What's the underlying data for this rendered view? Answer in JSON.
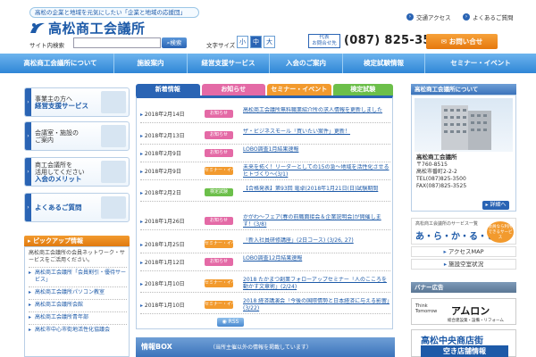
{
  "header": {
    "tagline": "高松の企業と地域を元気にしたい「企業と地域の応援団」",
    "logo_text": "高松商工会議所",
    "search_label": "サイト内検索",
    "search_placeholder": "",
    "search_button": "検索",
    "fontsize_label": "文字サイズ",
    "fontsize_options": [
      "小",
      "中",
      "大"
    ],
    "rep_tel_label": "代表\nお問合せ先",
    "tel_number": "(087) 825-3500",
    "contact_button": "お問い合せ",
    "toplinks": [
      "交通アクセス",
      "よくあるご質問"
    ]
  },
  "nav": {
    "items": [
      "高松商工会議所について",
      "施設案内",
      "経営支援サービス",
      "入会のご案内",
      "検定試験情報",
      "セミナー・イベント"
    ]
  },
  "left": {
    "boxes": [
      {
        "line1": "事業主の方へ",
        "line2": "経営支援サービス"
      },
      {
        "line1": "会議室・施設の",
        "line2": "ご案内"
      },
      {
        "line1": "商工会議所を",
        "line1b": "活用してください",
        "line2": "入会のメリット"
      },
      {
        "line1": "",
        "line2": "よくあるご質問"
      }
    ],
    "pickup_title": "ピックアップ情報",
    "pickup_desc": "高松商工会議所の会員ネットワーク・サービスをご活用ください。",
    "pickup_items": [
      "高松商工会議所「会員割引・優待サービス」",
      "高松商工会議所パソコン教室",
      "高松商工会議所会館",
      "高松商工会議所青年部",
      "高松市中心市街地活性化協議会"
    ]
  },
  "center": {
    "tabs": [
      {
        "label": "新着情報",
        "color": "#2a64b4"
      },
      {
        "label": "お知らせ",
        "color": "#e46aa6"
      },
      {
        "label": "セミナー・イベント",
        "color": "#f29a2e"
      },
      {
        "label": "検定試験",
        "color": "#6cbf4a"
      }
    ],
    "news": [
      {
        "date": "2018年2月14日",
        "badge": "お知らせ",
        "badge_color": "#e46aa6",
        "title": "高松商工会議所無料職業紹介所の求人情報を更新しました"
      },
      {
        "date": "2018年2月13日",
        "badge": "お知らせ",
        "badge_color": "#e46aa6",
        "title": "ザ・ビジネスモール「買いたい案件」更新！"
      },
      {
        "date": "2018年2月9日",
        "badge": "お知らせ",
        "badge_color": "#e46aa6",
        "title": "LOBO調査1月結果速報"
      },
      {
        "date": "2018年2月9日",
        "badge": "セミナー・イベント",
        "badge_color": "#f29a2e",
        "title": "未来を拓く！リーダーとしての15の急～地域を活性化させるヒトづくり～(3/1)"
      },
      {
        "date": "2018年2月2日",
        "badge": "検定試験",
        "badge_color": "#6cbf4a",
        "title": "【合格発表】第93回 電卓(2018年1月21日(日)試験期間"
      },
      {
        "date": "2018年1月26日",
        "badge": "お知らせ",
        "badge_color": "#e46aa6",
        "title": "かがわ～フェア(春の前職面接会＆企業説明会)が開催します！(3/8)"
      },
      {
        "date": "2018年1月25日",
        "badge": "セミナー・イベント",
        "badge_color": "#f29a2e",
        "title": "「新入社員研修講座」(2日コース) (3/26, 27)"
      },
      {
        "date": "2018年1月12日",
        "badge": "お知らせ",
        "badge_color": "#e46aa6",
        "title": "LOBO調査12月結果速報"
      },
      {
        "date": "2018年1月10日",
        "badge": "セミナー・イベント",
        "badge_color": "#f29a2e",
        "title": "2018 たかまつ創業フォローアップセミナー「人のこころを動かす文章術」(2/24)"
      },
      {
        "date": "2018年1月10日",
        "badge": "セミナー・イベント",
        "badge_color": "#f29a2e",
        "title": "2018 経済講演会「今後の国際情勢と日本経済に与える影響」(3/22)"
      }
    ],
    "rss": "RSS",
    "infobox_title": "情報BOX",
    "infobox_note": "（当所主催以外の情報を掲載しています）"
  },
  "right": {
    "about_title": "高松商工会議所について",
    "org_name": "高松商工会議所",
    "postal": "〒760-8515",
    "address": "高松市番町2-2-2",
    "tel": "TEL(087)825-3500",
    "fax": "FAX(087)825-3525",
    "detail_button": "詳細へ",
    "services_top": "高松商工会議所のサービス一覧",
    "services_main": "あ・ら・か・る・と",
    "services_badge": "会員なら利用できるサービス",
    "links": [
      "アクセスMAP",
      "施設空室状況"
    ],
    "banner_title": "バナー広告",
    "ad1_small": "Think\nTomorrow",
    "ad1_main": "アムロン",
    "ad1_sub": "総合建設業・設備・リフォーム",
    "ad2_main": "高松中央商店街",
    "ad2_sub": "空き店舗情報"
  }
}
